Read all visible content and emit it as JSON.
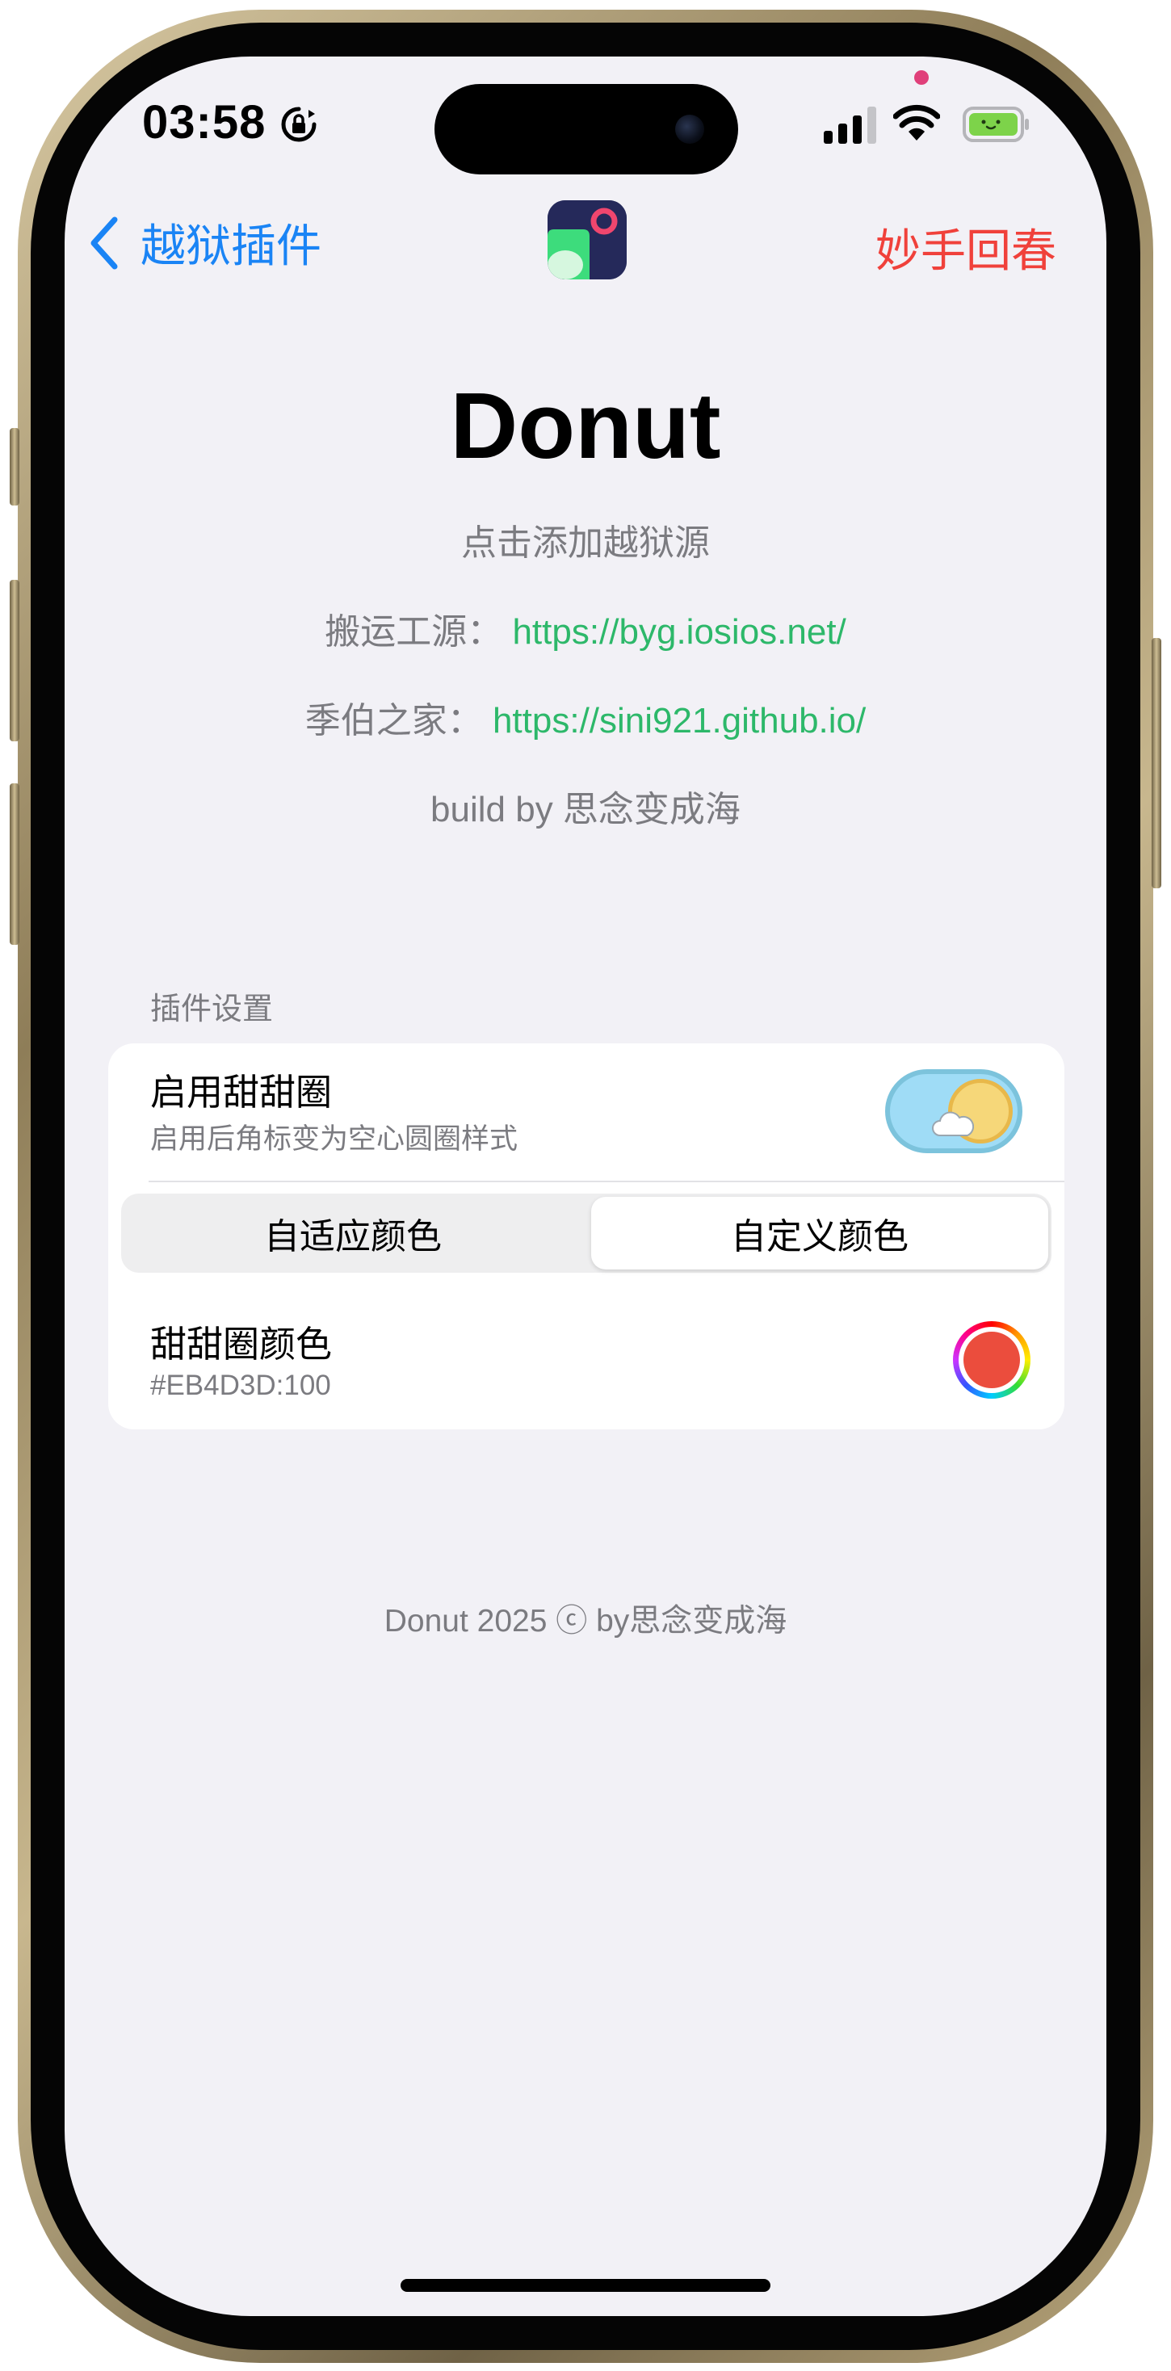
{
  "status_bar": {
    "time": "03:58",
    "icons": [
      "rotation-lock-icon",
      "cellular-signal-icon",
      "wifi-icon",
      "battery-icon"
    ]
  },
  "nav": {
    "back_label": "越狱插件",
    "action_label": "妙手回春",
    "app_icon": "donut-app-icon"
  },
  "header": {
    "title": "Donut",
    "subtitle": "点击添加越狱源",
    "source1_label": "搬运工源：",
    "source1_url": "https://byg.iosios.net/",
    "source2_label": "季伯之家：",
    "source2_url": "https://sini921.github.io/",
    "credit": "build by 思念变成海"
  },
  "settings": {
    "section_title": "插件设置",
    "enable_title": "启用甜甜圈",
    "enable_subtitle": "启用后角标变为空心圆圈样式",
    "enabled": true,
    "segments": [
      "自适应颜色",
      "自定义颜色"
    ],
    "selected_segment": "自定义颜色",
    "color_title": "甜甜圈颜色",
    "color_value": "#EB4D3D:100"
  },
  "footer": "Donut 2025 ⓒ by思念变成海",
  "colors": {
    "accent_blue": "#1a84f5",
    "destructive_red": "#f0413b",
    "link_green": "#2db86a",
    "donut_color": "#EB4D3D",
    "background": "#f2f1f6"
  }
}
